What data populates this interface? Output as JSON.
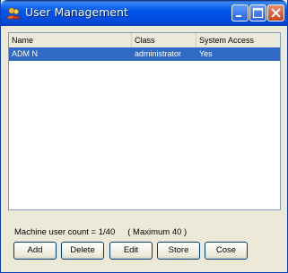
{
  "window": {
    "title": "User Management",
    "icon": "user-management-app-icon",
    "controls": [
      "minimize-icon",
      "maximize-icon",
      "close-icon"
    ]
  },
  "table": {
    "columns": [
      "Name",
      "Class",
      "System Access"
    ],
    "rows": [
      {
        "name": "ADM N",
        "class": "administrator",
        "system_access": "Yes",
        "selected": true
      }
    ]
  },
  "footer": {
    "count_label": "Machine user count = 1/40",
    "max_label": "( Maximum 40 )"
  },
  "buttons": {
    "add": "Add",
    "delete": "Delete",
    "edit": "Edit",
    "store": "Store",
    "close": "Cose"
  },
  "colors": {
    "titlebar": "#0058ee",
    "selection": "#316ac5",
    "window_bg": "#ece9d8"
  }
}
